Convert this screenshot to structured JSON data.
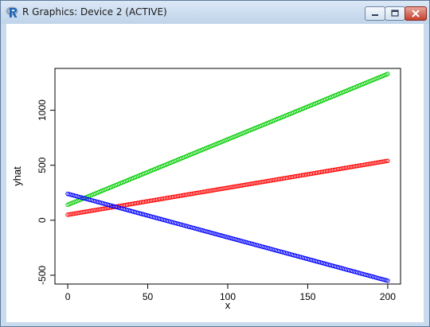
{
  "window": {
    "title": "R Graphics: Device 2 (ACTIVE)",
    "controls": {
      "minimize_icon": "minimize-icon",
      "maximize_icon": "maximize-icon",
      "close_icon": "close-icon"
    }
  },
  "chart_data": {
    "type": "scatter",
    "xlabel": "x",
    "ylabel": "yhat",
    "xlim": [
      -8,
      208
    ],
    "ylim": [
      -580,
      1380
    ],
    "xticks": [
      0,
      50,
      100,
      150,
      200
    ],
    "yticks": [
      -500,
      0,
      500,
      1000
    ],
    "xtick_labels": [
      "0",
      "50",
      "100",
      "150",
      "200"
    ],
    "ytick_labels": [
      "-500",
      "0",
      "500",
      "1000"
    ],
    "marker": "open-circle",
    "series": [
      {
        "color": "#00cd00",
        "x_start": 0,
        "x_end": 200,
        "x_step": 1,
        "y_start": 140,
        "y_end": 1330
      },
      {
        "color": "#ff0000",
        "x_start": 0,
        "x_end": 200,
        "x_step": 1,
        "y_start": 50,
        "y_end": 540
      },
      {
        "color": "#0000ff",
        "x_start": 0,
        "x_end": 200,
        "x_step": 1,
        "y_start": 240,
        "y_end": -550
      }
    ]
  }
}
